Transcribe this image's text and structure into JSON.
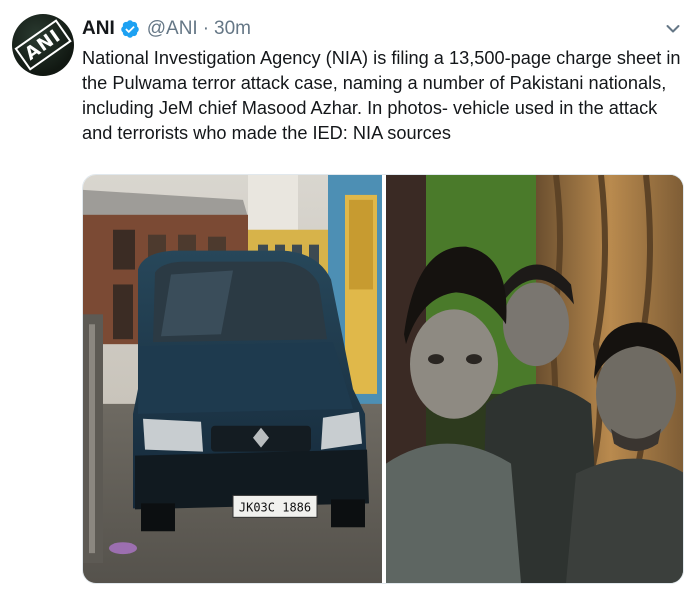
{
  "tweet": {
    "author_name": "ANI",
    "avatar_text": "ANI",
    "handle": "@ANI",
    "separator": "·",
    "time": "30m",
    "text_lines": [
      "National Investigation Agency (NIA) is filing a 13,500-page charge sheet in",
      "the Pulwama terror attack case, naming a number of Pakistani nationals,",
      "including JeM chief Masood Azhar. In photos- vehicle used in the attack",
      "and terrorists who made the IED: NIA sources"
    ],
    "verified_icon": "verified-badge-icon",
    "menu_icon": "chevron-down-icon"
  },
  "media": {
    "photos": [
      {
        "subject": "car-photo",
        "plate_text": "JK03C 1886"
      },
      {
        "subject": "group-selfie-photo"
      }
    ]
  },
  "colors": {
    "text": "#14171a",
    "secondary": "#657786",
    "verified": "#1da1f2",
    "border": "#e1e8ed"
  }
}
